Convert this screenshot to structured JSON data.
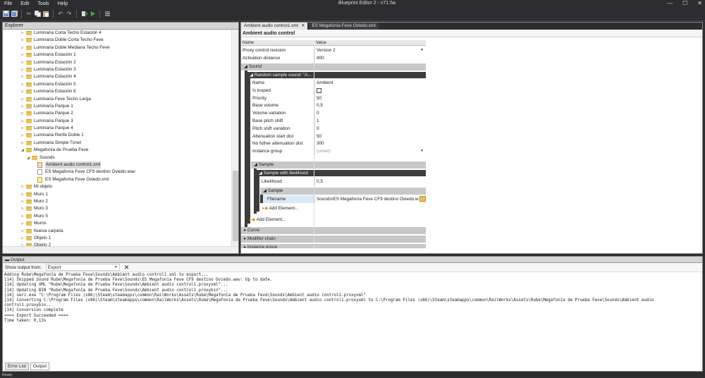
{
  "app": {
    "title": "Blueprint Editor 2 - v71.5a",
    "menu": [
      "File",
      "Edit",
      "Tools",
      "Help"
    ],
    "window_buttons": [
      "—",
      "☐",
      "✕"
    ]
  },
  "explorer": {
    "title": "Explorer",
    "items": [
      {
        "label": "Luminaria Corta Techo Estación 4",
        "type": "folder",
        "level": 0,
        "arrow": "▷"
      },
      {
        "label": "Luminaria Doble Corta Techo Feve",
        "type": "folder",
        "level": 0,
        "arrow": "▷"
      },
      {
        "label": "Luminaria Doble Mediana Techo Feve",
        "type": "folder",
        "level": 0,
        "arrow": "▷"
      },
      {
        "label": "Luminaria Estación 1",
        "type": "folder",
        "level": 0,
        "arrow": "▷"
      },
      {
        "label": "Luminaria Estación 2",
        "type": "folder",
        "level": 0,
        "arrow": "▷"
      },
      {
        "label": "Luminaria Estación 3",
        "type": "folder",
        "level": 0,
        "arrow": "▷"
      },
      {
        "label": "Luminaria Estación 4",
        "type": "folder",
        "level": 0,
        "arrow": "▷"
      },
      {
        "label": "Luminaria Estación 5",
        "type": "folder",
        "level": 0,
        "arrow": "▷"
      },
      {
        "label": "Luminaria Estación 6",
        "type": "folder",
        "level": 0,
        "arrow": "▷"
      },
      {
        "label": "Luminaria Feve Techo Larga",
        "type": "folder",
        "level": 0,
        "arrow": "▷"
      },
      {
        "label": "Luminaria Parque 1",
        "type": "folder",
        "level": 0,
        "arrow": "▷"
      },
      {
        "label": "Luminaria Parque 2",
        "type": "folder",
        "level": 0,
        "arrow": "▷"
      },
      {
        "label": "Luminaria Parque 3",
        "type": "folder",
        "level": 0,
        "arrow": "▷"
      },
      {
        "label": "Luminaria Parque 4",
        "type": "folder",
        "level": 0,
        "arrow": "▷"
      },
      {
        "label": "Luminaria Renfe Doble 1",
        "type": "folder",
        "level": 0,
        "arrow": "▷"
      },
      {
        "label": "Luminaria Simple Túnel",
        "type": "folder",
        "level": 0,
        "arrow": "▷"
      },
      {
        "label": "Megafonía de Prueba Feve",
        "type": "folder",
        "level": 0,
        "arrow": "◢"
      },
      {
        "label": "Sounds",
        "type": "folder",
        "level": 1,
        "arrow": "◢"
      },
      {
        "label": "Ambient audio control1.xml",
        "type": "xml",
        "level": 2,
        "arrow": "",
        "selected": true
      },
      {
        "label": "ES Megafonía Feve CF9 destino Oviedo.wav",
        "type": "wav",
        "level": 2,
        "arrow": ""
      },
      {
        "label": "ES Megafonía Feve Oviedo.xml",
        "type": "wav2",
        "level": 2,
        "arrow": ""
      },
      {
        "label": "Mi objeto",
        "type": "folder",
        "level": 0,
        "arrow": "▷"
      },
      {
        "label": "Muro 1",
        "type": "folder",
        "level": 0,
        "arrow": "▷"
      },
      {
        "label": "Muro 2",
        "type": "folder",
        "level": 0,
        "arrow": "▷"
      },
      {
        "label": "Muro 3",
        "type": "folder",
        "level": 0,
        "arrow": "▷"
      },
      {
        "label": "Muro 5",
        "type": "folder",
        "level": 0,
        "arrow": "▷"
      },
      {
        "label": "Muros",
        "type": "folder",
        "level": 0,
        "arrow": "▷"
      },
      {
        "label": "Nueva carpeta",
        "type": "folder",
        "level": 0,
        "arrow": "▷"
      },
      {
        "label": "Objeto 1",
        "type": "folder",
        "level": 0,
        "arrow": "▷"
      },
      {
        "label": "Objeto 2",
        "type": "folder",
        "level": 0,
        "arrow": "▷"
      }
    ]
  },
  "editor": {
    "tabs": [
      {
        "label": "Ambient audio control1.xml",
        "close": "✕",
        "active": true
      },
      {
        "label": "ES Megafonía Feve Oviedo.xml",
        "close": "",
        "active": false
      }
    ],
    "doc_title": "Ambient audio control",
    "col_name": "Name",
    "col_value": "Value",
    "top_props": [
      {
        "name": "Proxy control revision",
        "value": "Version 2"
      },
      {
        "name": "Activation distance",
        "value": "400"
      }
    ],
    "sound_header": "◢  Sound",
    "random_header": "◢  Random sample sound: \"A...",
    "sound_props": [
      {
        "name": "Name",
        "value": "Ambient"
      },
      {
        "name": "Is looped",
        "value": ""
      },
      {
        "name": "Priority",
        "value": "50"
      },
      {
        "name": "Base volume",
        "value": "0,5"
      },
      {
        "name": "Volume variation",
        "value": "0"
      },
      {
        "name": "Base pitch shift",
        "value": "1"
      },
      {
        "name": "Pitch shift variation",
        "value": "0"
      },
      {
        "name": "Attenuation start dist",
        "value": "50"
      },
      {
        "name": "No futher attenuation dist",
        "value": "300"
      },
      {
        "name": "Instance group",
        "value": "(unset)"
      }
    ],
    "sample_header": "◢  Sample",
    "likelihood_header": "◢  Sample with likelihood",
    "likelihood": {
      "name": "Likelihood",
      "value": "0,5"
    },
    "inner_sample_header": "◢  Sample",
    "filename": {
      "name": "Filename",
      "value": "Sounds\\ES Megafonía Feve CF9 destino Oviedo.wav"
    },
    "add_element_inner": "Add Element...",
    "add_element_outer": "Add Element...",
    "curve_header": "▸  Curve",
    "modifier_header": "▸  Modifier chain",
    "instance_header": "▸  Instance group"
  },
  "output": {
    "title": "Output",
    "show_from_label": "Show output from:",
    "show_from_value": "Export",
    "clear_label": "✕",
    "log": "Adding Rube\\Megafonía de Prueba Feve\\Sounds\\Ambient audio control1.xml to export...\n[14] Skipped Sound Rube\\Megafonía de Prueba Feve\\Sounds\\ES Megafonía Feve CF9 destino Oviedo.wav: Up to date.\n[14] Updating XML \"Rube\\Megafonía de Prueba Feve\\Sounds\\Ambient audio control1.proxyxml\"...\n[14] Updating BIN \"Rube\\Megafonía de Prueba Feve\\Sounds\\Ambient audio control1.proxybin\"...\n[14] serz.exe \"C:\\Program Files (x86)\\Steam\\steamapps\\common\\RailWorks\\Assets\\Rube\\Megafonía de Prueba Feve\\Sounds\\Ambient audio control1.proxyxml\"\n[14] Converting C:\\Program Files (x86)\\Steam\\steamapps\\common\\RailWorks\\Assets\\Rube\\Megafonía de Prueba Feve\\Sounds\\Ambient audio control1.proxyxml to C:\\Program Files (x86)\\Steam\\steamapps\\common\\RailWorks\\Assets\\Rube\\Megafonía de Prueba Feve\\Sounds\\Ambient audio control1.proxybin...\n[14] Conversion complete\n==== Export Succeeded ====\nTime taken: 0,13s",
    "tabs": [
      {
        "label": "Error List",
        "active": false
      },
      {
        "label": "Output",
        "active": true
      }
    ]
  },
  "status": {
    "text": "Ready"
  }
}
